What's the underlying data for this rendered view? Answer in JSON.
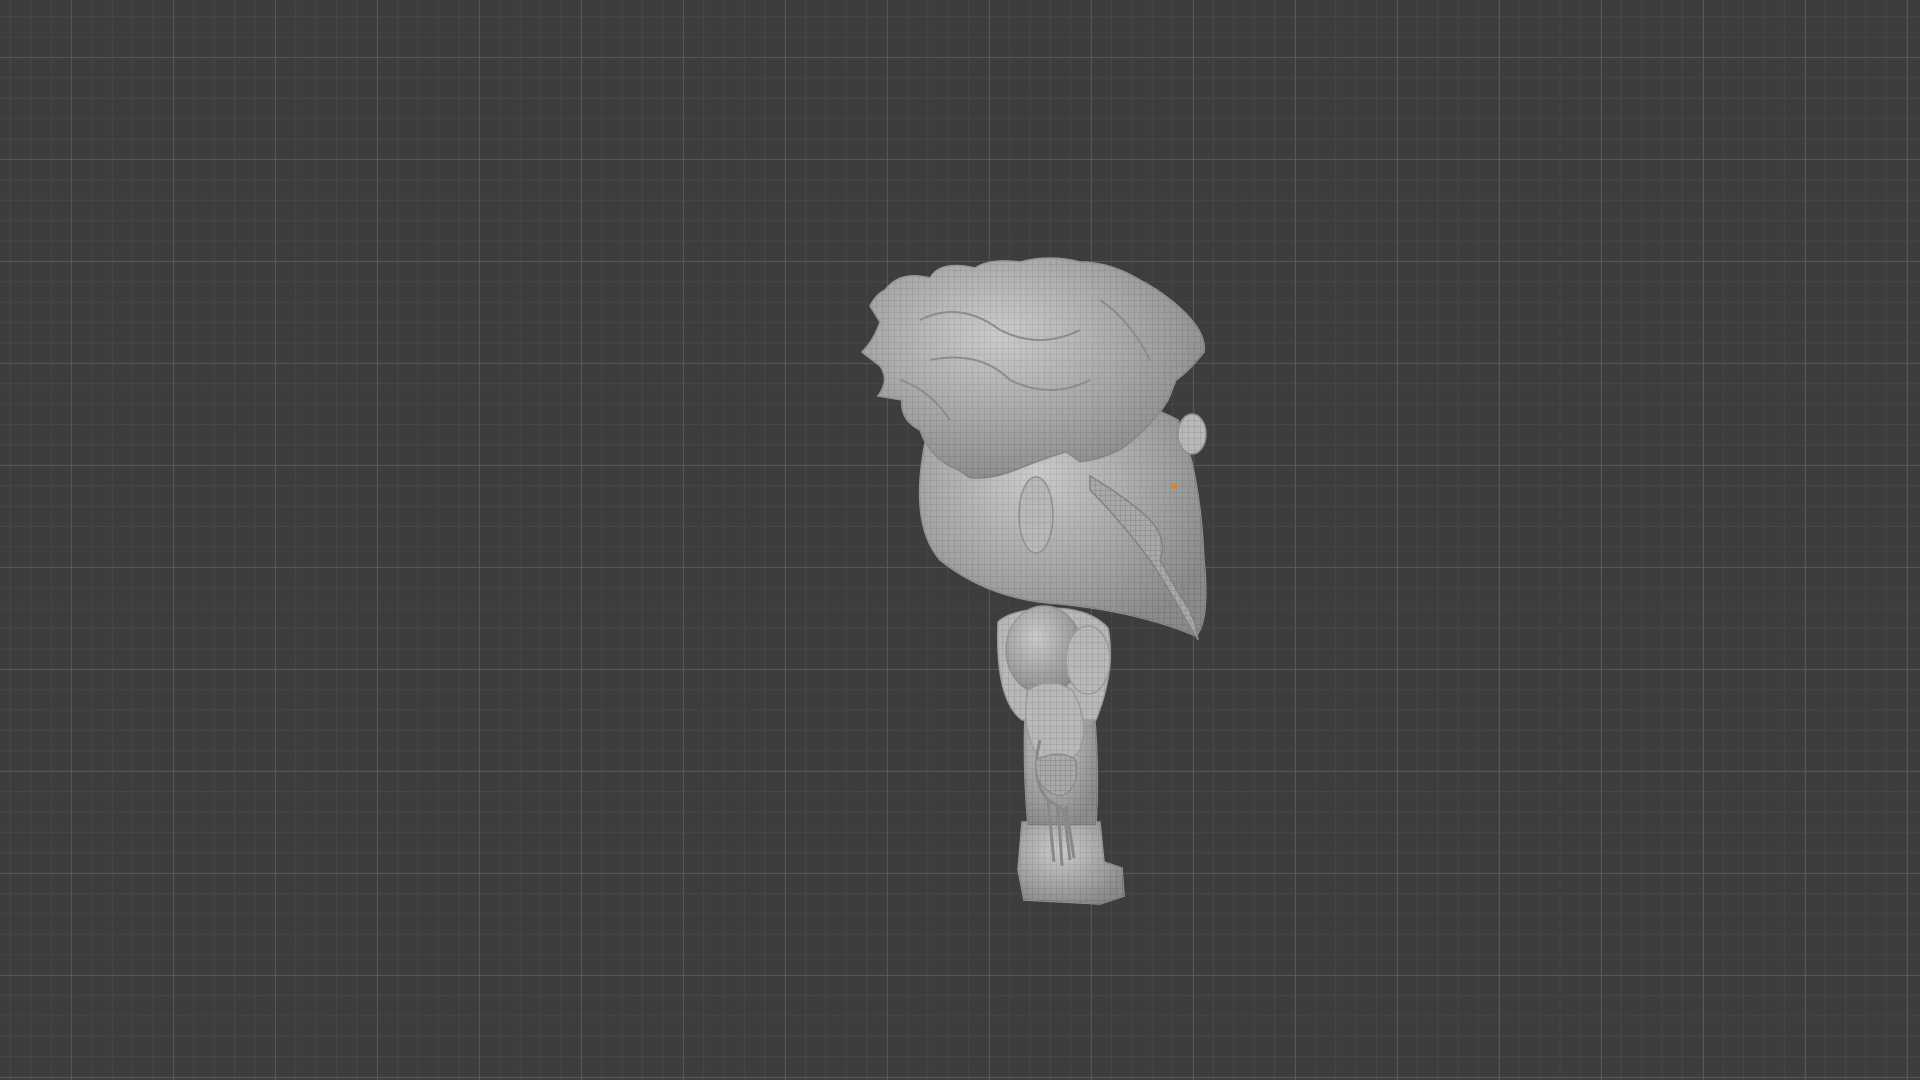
{
  "viewport": {
    "background_color": "#3d3d3d",
    "grid_color": "#5a5a5a",
    "model_color": "#b8b8b8",
    "model_wire_color": "#8a8a8a"
  },
  "model": {
    "icon": "mesh-object-icon",
    "view": "side-orthographic"
  }
}
